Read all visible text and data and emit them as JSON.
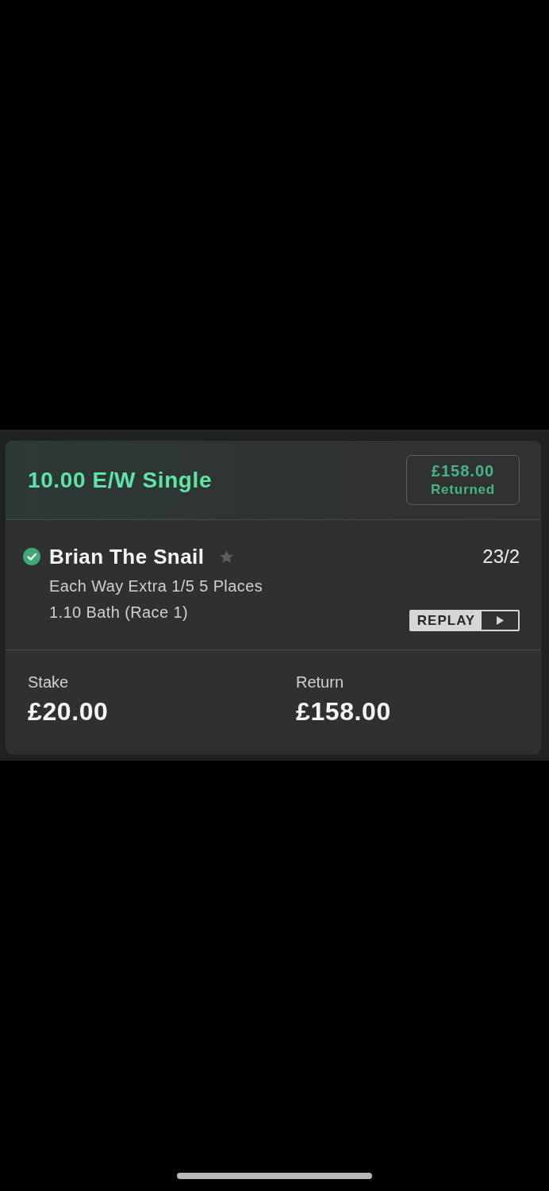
{
  "bet": {
    "title": "10.00 E/W Single",
    "status_badge": {
      "amount": "£158.00",
      "label": "Returned"
    }
  },
  "selection": {
    "name": "Brian The Snail",
    "won": true,
    "favourite": false,
    "odds": "23/2",
    "market": "Each Way Extra 1/5 5 Places",
    "event": "1.10 Bath (Race 1)",
    "replay_button": "REPLAY"
  },
  "totals": [
    {
      "label": "Stake",
      "value": "£20.00"
    },
    {
      "label": "Return",
      "value": "£158.00"
    }
  ]
}
